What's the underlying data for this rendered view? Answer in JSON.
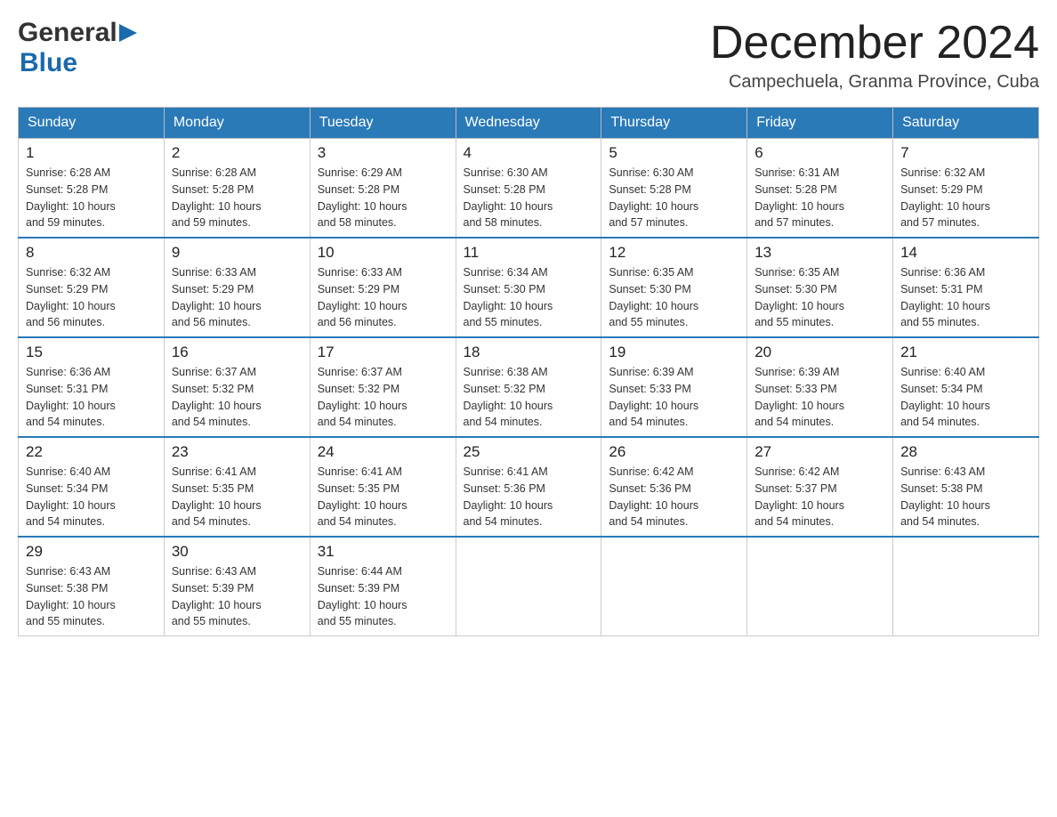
{
  "header": {
    "logo_general": "General",
    "logo_blue": "Blue",
    "month_title": "December 2024",
    "subtitle": "Campechuela, Granma Province, Cuba"
  },
  "days_of_week": [
    "Sunday",
    "Monday",
    "Tuesday",
    "Wednesday",
    "Thursday",
    "Friday",
    "Saturday"
  ],
  "weeks": [
    [
      {
        "day": "1",
        "sunrise": "6:28 AM",
        "sunset": "5:28 PM",
        "daylight": "10 hours and 59 minutes."
      },
      {
        "day": "2",
        "sunrise": "6:28 AM",
        "sunset": "5:28 PM",
        "daylight": "10 hours and 59 minutes."
      },
      {
        "day": "3",
        "sunrise": "6:29 AM",
        "sunset": "5:28 PM",
        "daylight": "10 hours and 58 minutes."
      },
      {
        "day": "4",
        "sunrise": "6:30 AM",
        "sunset": "5:28 PM",
        "daylight": "10 hours and 58 minutes."
      },
      {
        "day": "5",
        "sunrise": "6:30 AM",
        "sunset": "5:28 PM",
        "daylight": "10 hours and 57 minutes."
      },
      {
        "day": "6",
        "sunrise": "6:31 AM",
        "sunset": "5:28 PM",
        "daylight": "10 hours and 57 minutes."
      },
      {
        "day": "7",
        "sunrise": "6:32 AM",
        "sunset": "5:29 PM",
        "daylight": "10 hours and 57 minutes."
      }
    ],
    [
      {
        "day": "8",
        "sunrise": "6:32 AM",
        "sunset": "5:29 PM",
        "daylight": "10 hours and 56 minutes."
      },
      {
        "day": "9",
        "sunrise": "6:33 AM",
        "sunset": "5:29 PM",
        "daylight": "10 hours and 56 minutes."
      },
      {
        "day": "10",
        "sunrise": "6:33 AM",
        "sunset": "5:29 PM",
        "daylight": "10 hours and 56 minutes."
      },
      {
        "day": "11",
        "sunrise": "6:34 AM",
        "sunset": "5:30 PM",
        "daylight": "10 hours and 55 minutes."
      },
      {
        "day": "12",
        "sunrise": "6:35 AM",
        "sunset": "5:30 PM",
        "daylight": "10 hours and 55 minutes."
      },
      {
        "day": "13",
        "sunrise": "6:35 AM",
        "sunset": "5:30 PM",
        "daylight": "10 hours and 55 minutes."
      },
      {
        "day": "14",
        "sunrise": "6:36 AM",
        "sunset": "5:31 PM",
        "daylight": "10 hours and 55 minutes."
      }
    ],
    [
      {
        "day": "15",
        "sunrise": "6:36 AM",
        "sunset": "5:31 PM",
        "daylight": "10 hours and 54 minutes."
      },
      {
        "day": "16",
        "sunrise": "6:37 AM",
        "sunset": "5:32 PM",
        "daylight": "10 hours and 54 minutes."
      },
      {
        "day": "17",
        "sunrise": "6:37 AM",
        "sunset": "5:32 PM",
        "daylight": "10 hours and 54 minutes."
      },
      {
        "day": "18",
        "sunrise": "6:38 AM",
        "sunset": "5:32 PM",
        "daylight": "10 hours and 54 minutes."
      },
      {
        "day": "19",
        "sunrise": "6:39 AM",
        "sunset": "5:33 PM",
        "daylight": "10 hours and 54 minutes."
      },
      {
        "day": "20",
        "sunrise": "6:39 AM",
        "sunset": "5:33 PM",
        "daylight": "10 hours and 54 minutes."
      },
      {
        "day": "21",
        "sunrise": "6:40 AM",
        "sunset": "5:34 PM",
        "daylight": "10 hours and 54 minutes."
      }
    ],
    [
      {
        "day": "22",
        "sunrise": "6:40 AM",
        "sunset": "5:34 PM",
        "daylight": "10 hours and 54 minutes."
      },
      {
        "day": "23",
        "sunrise": "6:41 AM",
        "sunset": "5:35 PM",
        "daylight": "10 hours and 54 minutes."
      },
      {
        "day": "24",
        "sunrise": "6:41 AM",
        "sunset": "5:35 PM",
        "daylight": "10 hours and 54 minutes."
      },
      {
        "day": "25",
        "sunrise": "6:41 AM",
        "sunset": "5:36 PM",
        "daylight": "10 hours and 54 minutes."
      },
      {
        "day": "26",
        "sunrise": "6:42 AM",
        "sunset": "5:36 PM",
        "daylight": "10 hours and 54 minutes."
      },
      {
        "day": "27",
        "sunrise": "6:42 AM",
        "sunset": "5:37 PM",
        "daylight": "10 hours and 54 minutes."
      },
      {
        "day": "28",
        "sunrise": "6:43 AM",
        "sunset": "5:38 PM",
        "daylight": "10 hours and 54 minutes."
      }
    ],
    [
      {
        "day": "29",
        "sunrise": "6:43 AM",
        "sunset": "5:38 PM",
        "daylight": "10 hours and 55 minutes."
      },
      {
        "day": "30",
        "sunrise": "6:43 AM",
        "sunset": "5:39 PM",
        "daylight": "10 hours and 55 minutes."
      },
      {
        "day": "31",
        "sunrise": "6:44 AM",
        "sunset": "5:39 PM",
        "daylight": "10 hours and 55 minutes."
      },
      null,
      null,
      null,
      null
    ]
  ],
  "labels": {
    "sunrise": "Sunrise:",
    "sunset": "Sunset:",
    "daylight": "Daylight:"
  }
}
